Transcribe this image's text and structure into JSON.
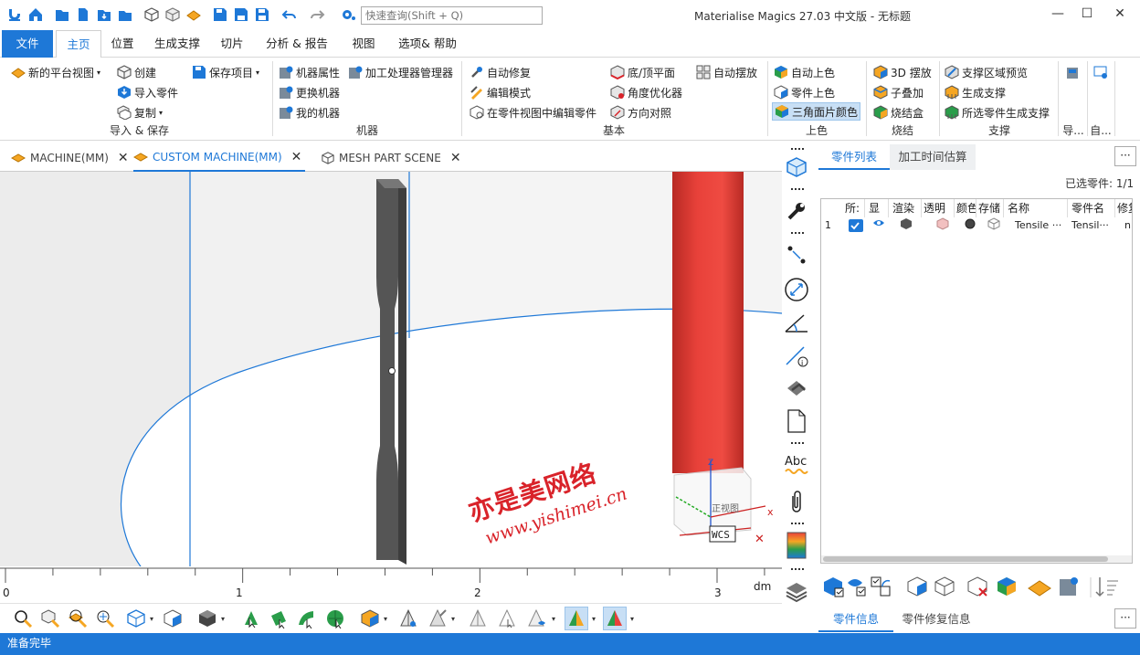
{
  "titlebar": {
    "app_title": "Materialise Magics 27.03 中文版 - 无标题",
    "search_placeholder": "快速查询(Shift + Q)",
    "minimize": "—",
    "maximize": "☐",
    "close": "✕"
  },
  "ribbon_tabs": [
    "文件",
    "主页",
    "位置",
    "生成支撑",
    "切片",
    "分析 & 报告",
    "视图",
    "选项& 帮助"
  ],
  "ribbon": {
    "groups": {
      "import_save": "导入 & 保存",
      "machine": "机器",
      "basic": "基本",
      "color": "上色",
      "sinter": "烧结",
      "support": "支撑",
      "import_short": "导...",
      "auto_short": "自..."
    },
    "import_save": {
      "new_platform_view": "新的平台视图",
      "create": "创建",
      "import_part": "导入零件",
      "copy": "复制",
      "save_project": "保存项目"
    },
    "machine": {
      "machine_properties": "机器属性",
      "change_machine": "更换机器",
      "my_machines": "我的机器",
      "processor_manager": "加工处理器管理器"
    },
    "basic": {
      "auto_fix": "自动修复",
      "edit_mode": "编辑模式",
      "edit_in_part_view": "在零件视图中编辑零件",
      "bottom_top_plane": "底/顶平面",
      "angle_optimizer": "角度优化器",
      "orientation": "方向对照",
      "auto_placement": "自动摆放"
    },
    "color": {
      "auto_color": "自动上色",
      "part_color": "零件上色",
      "triangle_color": "三角面片颜色"
    },
    "sinter": {
      "placement_3d": "3D 摆放",
      "sub_stack": "子叠加",
      "sinter_box": "烧结盒"
    },
    "support": {
      "region_preview": "支撑区域预览",
      "generate_support": "生成支撑",
      "generate_selected": "所选零件生成支撑"
    }
  },
  "doc_tabs": [
    {
      "label": "MACHINE(MM)",
      "active": false
    },
    {
      "label": "CUSTOM MACHINE(MM)",
      "active": true
    },
    {
      "label": "MESH PART SCENE",
      "active": false
    }
  ],
  "viewport": {
    "ruler_ticks": [
      "0",
      "1",
      "2",
      "3"
    ],
    "ruler_unit": "dm",
    "view_cube_label": "正视图",
    "wcs_label": "WCS",
    "axis_x": "x",
    "axis_z": "Z",
    "watermark_cn": "亦是美网络",
    "watermark_url": "www.yishimei.cn"
  },
  "right_panel": {
    "tabs": [
      "零件列表",
      "加工时间估算"
    ],
    "selected_label": "已选零件:",
    "selected_value": "1/1",
    "more": "···",
    "columns": [
      "所:",
      "显",
      "渲染",
      "透明",
      "颜色",
      "存储",
      "名称",
      "零件名",
      "修复"
    ],
    "rows": [
      {
        "index": "1",
        "name": "Tensile ···",
        "part_name": "Tensil···",
        "fix": "n"
      }
    ],
    "bottom_tabs": [
      "零件信息",
      "零件修复信息"
    ]
  },
  "status": {
    "text": "准备完毕"
  },
  "colors": {
    "accent": "#1e78d7",
    "status_bar": "#1e78d7",
    "red_part": "#e8413a",
    "gray_part": "#5a5a5a"
  }
}
